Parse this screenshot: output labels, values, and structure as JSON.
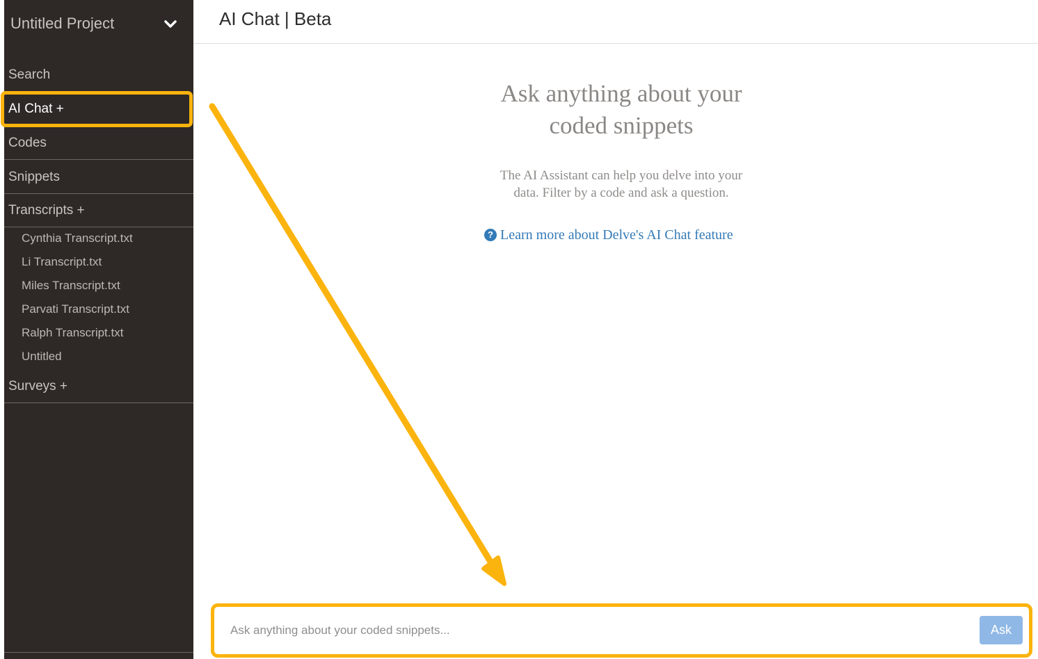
{
  "project": {
    "title": "Untitled Project",
    "dropdown_icon": "chevron-down-icon"
  },
  "sidebar": {
    "nav": {
      "search": "Search",
      "ai_chat": "AI Chat +",
      "codes": "Codes",
      "snippets": "Snippets",
      "transcripts": "Transcripts +",
      "surveys": "Surveys +"
    },
    "transcripts": [
      "Cynthia Transcript.txt",
      "Li Transcript.txt",
      "Miles Transcript.txt",
      "Parvati Transcript.txt",
      "Ralph Transcript.txt",
      "Untitled"
    ],
    "active_item": "AI Chat +"
  },
  "header": {
    "title": "AI Chat | Beta"
  },
  "main": {
    "hero_title_line1": "Ask anything about your",
    "hero_title_line2": "coded snippets",
    "description_line1": "The AI Assistant can help you delve into your",
    "description_line2": "data. Filter by a code and ask a question.",
    "help_icon": "question-circle-icon",
    "learn_more": "Learn more about Delve's AI Chat feature"
  },
  "ask_bar": {
    "placeholder": "Ask anything about your coded snippets...",
    "value": "",
    "button_label": "Ask"
  },
  "colors": {
    "sidebar_bg": "#2e2926",
    "highlight": "#fbb30d",
    "link": "#337ab7",
    "ask_button": "#8fb8e6"
  }
}
